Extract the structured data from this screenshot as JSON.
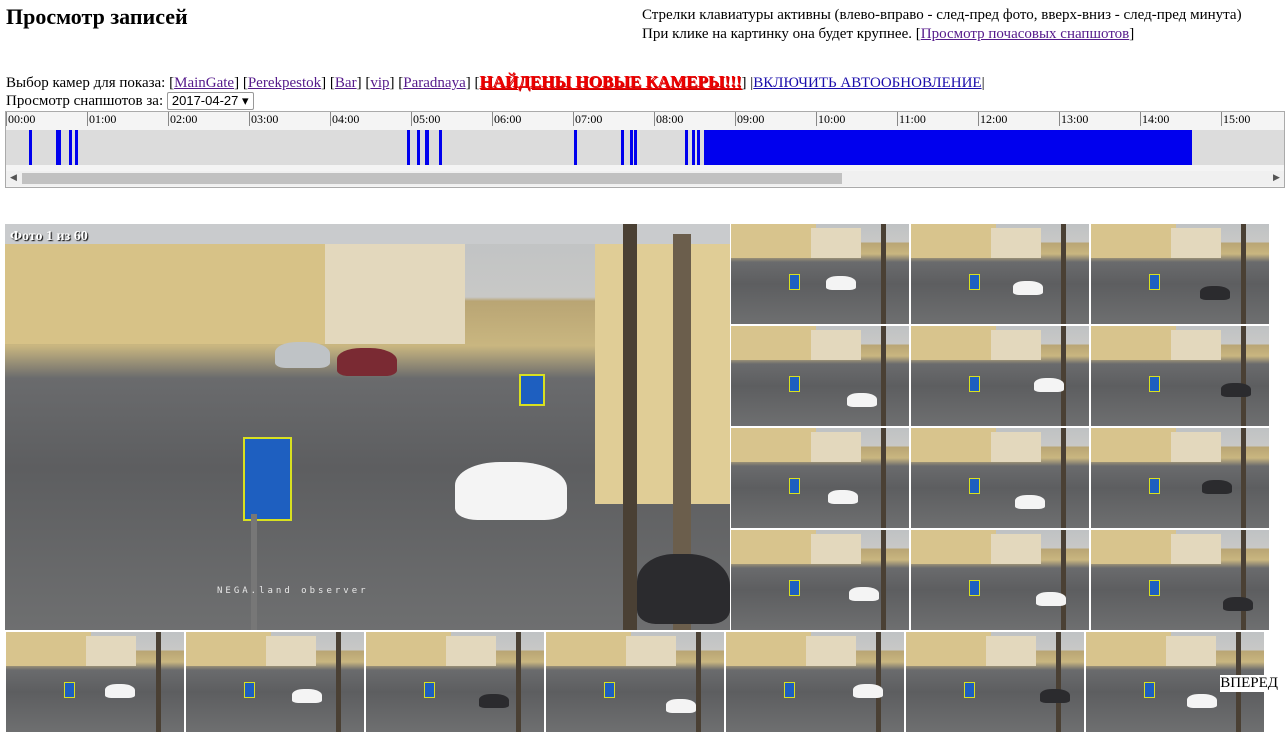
{
  "header": {
    "title": "Просмотр записей",
    "help_line1": "Стрелки клавиатуры активны (влево-вправо - след-пред фото, вверх-вниз - след-пред минута)",
    "help_line2_pre": "При клике на картинку она будет крупнее. [",
    "hourly_link": "Просмотр почасовых снапшотов",
    "help_line2_post": "]"
  },
  "cameras": {
    "label": "Выбор камер для показа:",
    "items": [
      "MainGate",
      "Perekpestok",
      "Bar",
      "vip",
      "Paradnaya"
    ],
    "new_cameras": "НАЙДЕНЫ НОВЫЕ КАМЕРЫ!!!",
    "autorefresh": "ВКЛЮЧИТЬ АВТООБНОВЛЕНИЕ"
  },
  "date": {
    "label": "Просмотр снапшотов за:",
    "value": "2017-04-27"
  },
  "timeline": {
    "hours": [
      "00:00",
      "01:00",
      "02:00",
      "03:00",
      "04:00",
      "05:00",
      "06:00",
      "07:00",
      "08:00",
      "09:00",
      "10:00",
      "11:00",
      "12:00",
      "13:00",
      "14:00",
      "15:00"
    ],
    "segments_hours": [
      [
        0.14,
        0.17
      ],
      [
        0.47,
        0.53
      ],
      [
        0.63,
        0.65
      ],
      [
        0.7,
        0.74
      ],
      [
        4.8,
        4.83
      ],
      [
        4.92,
        4.96
      ],
      [
        5.03,
        5.08
      ],
      [
        5.2,
        5.23
      ],
      [
        6.87,
        6.89
      ],
      [
        7.44,
        7.46
      ],
      [
        7.56,
        7.58
      ],
      [
        7.6,
        7.62
      ],
      [
        8.24,
        8.27
      ],
      [
        8.32,
        8.34
      ],
      [
        8.38,
        8.4
      ],
      [
        8.47,
        14.5
      ]
    ],
    "fill_color": "#0000ee"
  },
  "viewer": {
    "overlay": "Фото 1 из 60",
    "watermark": "NEGA.land observer",
    "thumb_count": 19,
    "forward": "ВПЕРЕД"
  }
}
